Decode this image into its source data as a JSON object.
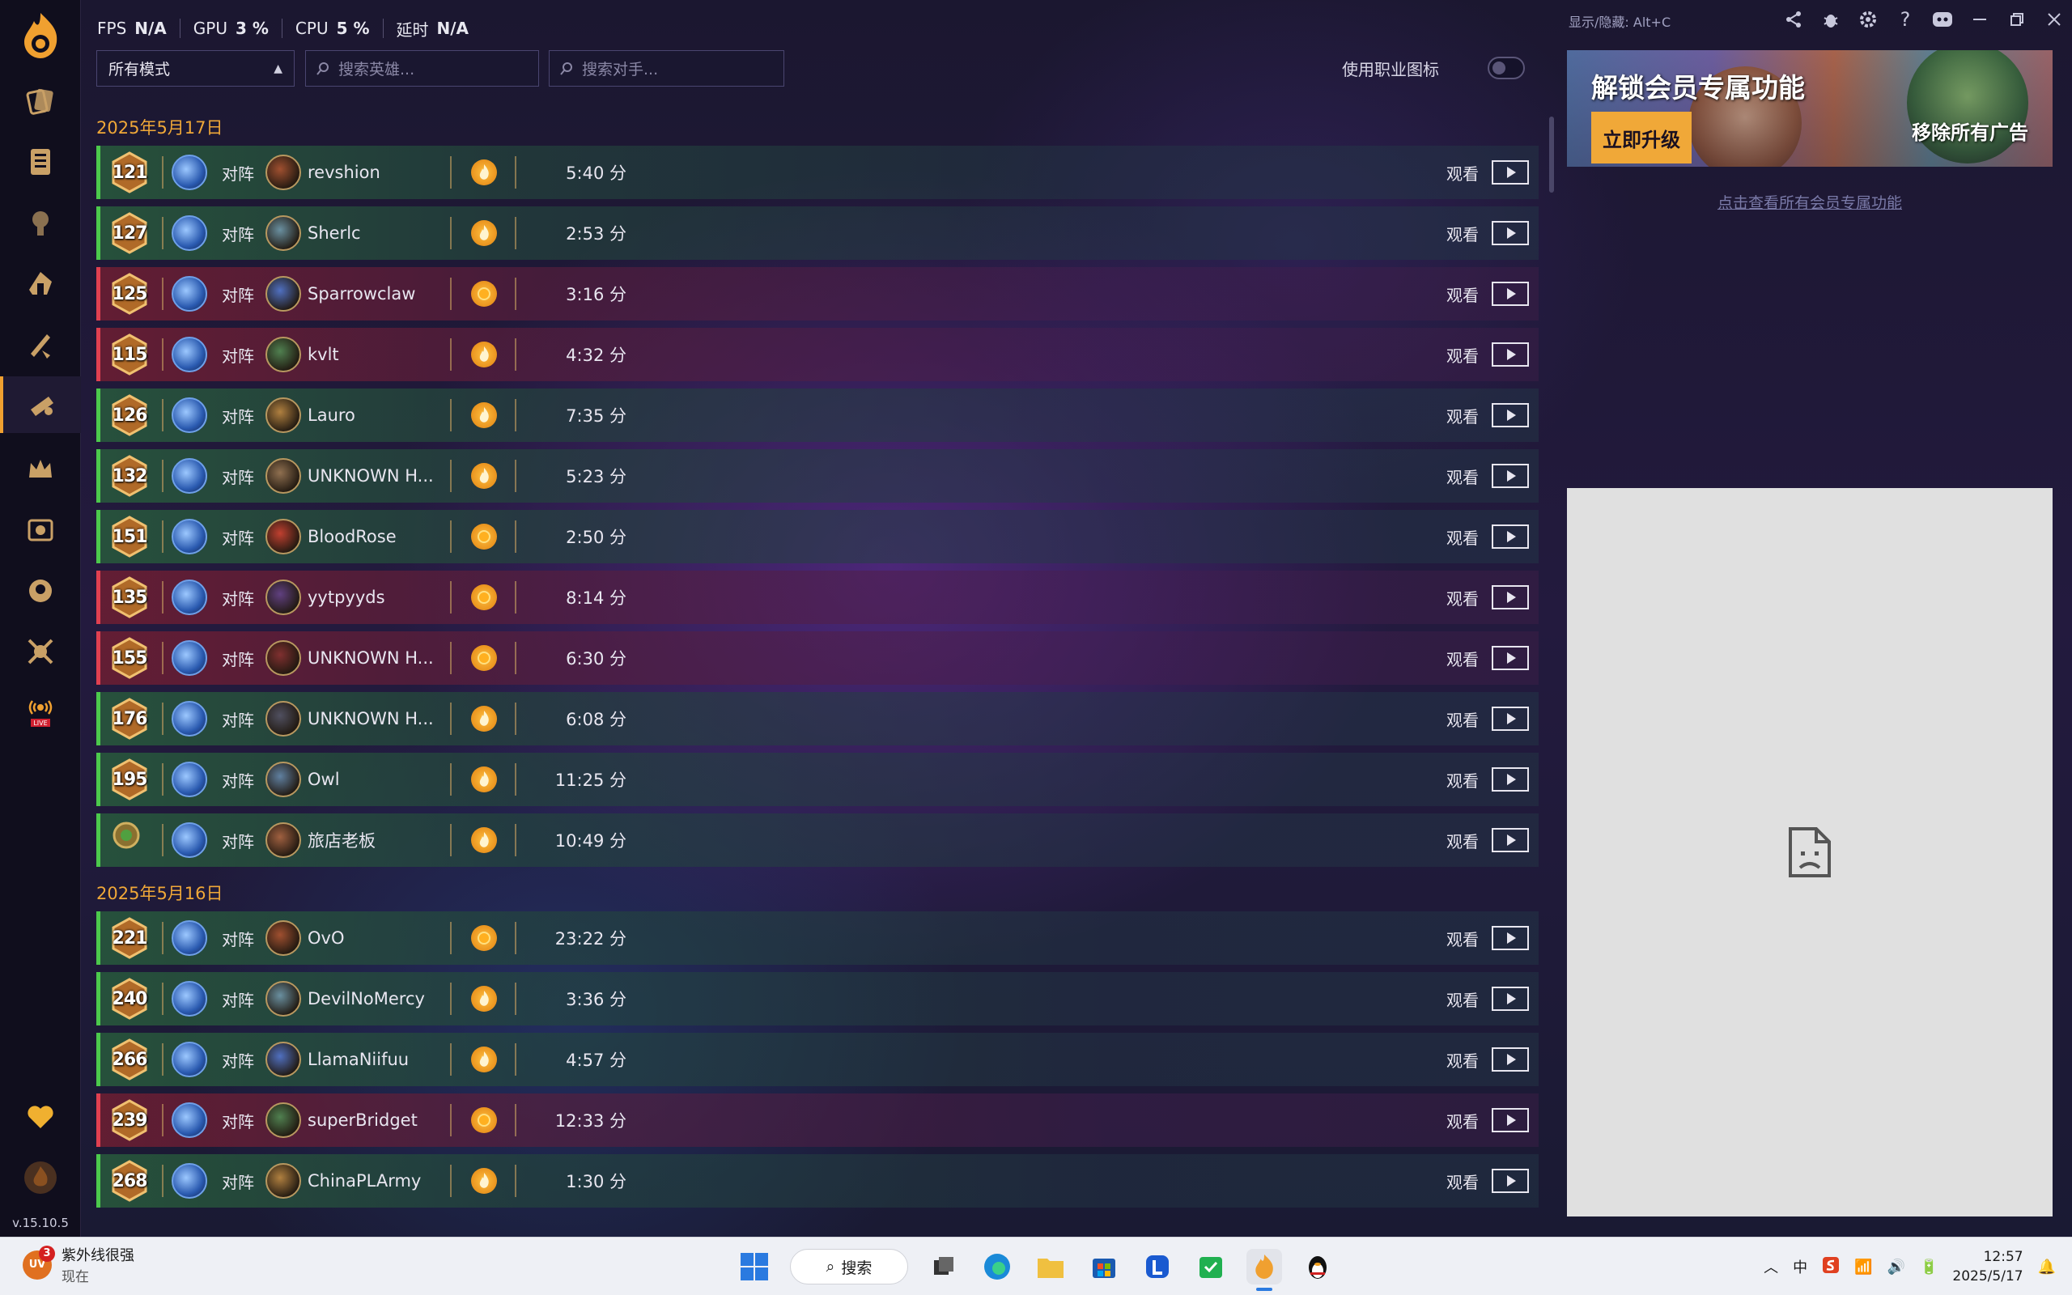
{
  "stats": {
    "fps_label": "FPS",
    "fps_value": "N/A",
    "gpu_label": "GPU",
    "gpu_value": "3 %",
    "cpu_label": "CPU",
    "cpu_value": "5 %",
    "latency_label": "延时",
    "latency_value": "N/A"
  },
  "filters": {
    "mode": "所有模式",
    "hero_placeholder": "搜索英雄...",
    "opponent_placeholder": "搜索对手...",
    "class_icon_label": "使用职业图标"
  },
  "sidebar": {
    "version": "v.15.10.5"
  },
  "vs_label": "对阵",
  "watch_label": "观看",
  "groups": [
    {
      "date": "2025年5月17日",
      "rows": [
        {
          "rank": "121",
          "result": "win",
          "opponent": "revshion",
          "coin": "flame",
          "duration": "5:40 分"
        },
        {
          "rank": "127",
          "result": "win",
          "opponent": "Sherlc",
          "coin": "flame",
          "duration": "2:53 分"
        },
        {
          "rank": "125",
          "result": "loss",
          "opponent": "Sparrowclaw",
          "coin": "coin",
          "duration": "3:16 分"
        },
        {
          "rank": "115",
          "result": "loss",
          "opponent": "kvlt",
          "coin": "flame",
          "duration": "4:32 分"
        },
        {
          "rank": "126",
          "result": "win",
          "opponent": "Lauro",
          "coin": "flame",
          "duration": "7:35 分"
        },
        {
          "rank": "132",
          "result": "win",
          "opponent": "UNKNOWN H...",
          "coin": "flame",
          "duration": "5:23 分"
        },
        {
          "rank": "151",
          "result": "win",
          "opponent": "BloodRose",
          "coin": "coin",
          "duration": "2:50 分"
        },
        {
          "rank": "135",
          "result": "loss",
          "opponent": "yytpyyds",
          "coin": "coin",
          "duration": "8:14 分"
        },
        {
          "rank": "155",
          "result": "loss",
          "opponent": "UNKNOWN H...",
          "coin": "coin",
          "duration": "6:30 分"
        },
        {
          "rank": "176",
          "result": "win",
          "opponent": "UNKNOWN H...",
          "coin": "flame",
          "duration": "6:08 分"
        },
        {
          "rank": "195",
          "result": "win",
          "opponent": "Owl",
          "coin": "flame",
          "duration": "11:25 分"
        },
        {
          "rank": "",
          "result": "win",
          "opponent": "旅店老板",
          "coin": "flame",
          "duration": "10:49 分"
        }
      ]
    },
    {
      "date": "2025年5月16日",
      "rows": [
        {
          "rank": "221",
          "result": "win",
          "opponent": "OvO",
          "coin": "coin",
          "duration": "23:22 分"
        },
        {
          "rank": "240",
          "result": "win",
          "opponent": "DevilNoMercy",
          "coin": "flame",
          "duration": "3:36 分"
        },
        {
          "rank": "266",
          "result": "win",
          "opponent": "LlamaNiifuu",
          "coin": "flame",
          "duration": "4:57 分"
        },
        {
          "rank": "239",
          "result": "loss",
          "opponent": "superBridget",
          "coin": "coin",
          "duration": "12:33 分"
        },
        {
          "rank": "268",
          "result": "win",
          "opponent": "ChinaPLArmy",
          "coin": "flame",
          "duration": "1:30 分"
        }
      ]
    }
  ],
  "panel": {
    "hotkey": "显示/隐藏: Alt+C",
    "banner_title": "解锁会员专属功能",
    "upgrade": "立即升级",
    "remove_ads": "移除所有广告",
    "vip_link": "点击查看所有会员专属功能"
  },
  "taskbar": {
    "weather_badge": "3",
    "weather_icon_text": "UV",
    "weather_title": "紫外线很强",
    "weather_sub": "现在",
    "search": "搜索",
    "ime": "中",
    "time": "12:57",
    "date": "2025/5/17"
  }
}
